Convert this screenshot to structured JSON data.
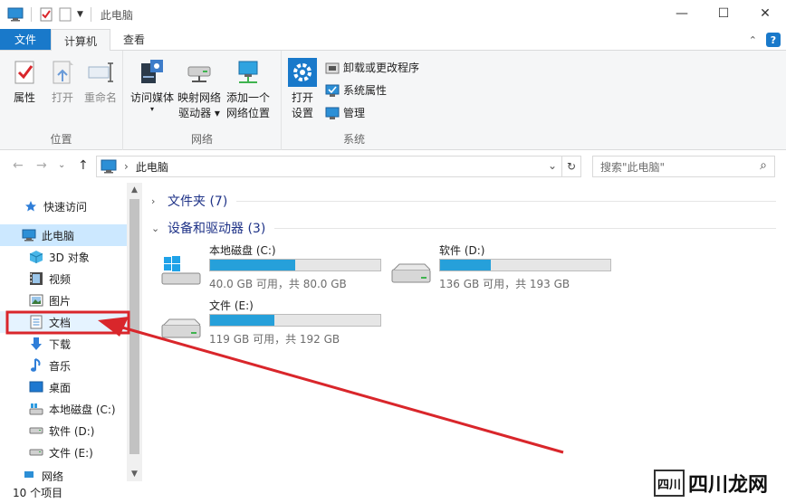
{
  "window": {
    "title": "此电脑",
    "minimize_glyph": "—",
    "maximize_glyph": "☐",
    "close_glyph": "✕"
  },
  "ribbon_tabs": [
    {
      "label": "文件"
    },
    {
      "label": "计算机"
    },
    {
      "label": "查看"
    }
  ],
  "ribbon": {
    "location_group": {
      "label": "位置",
      "buttons": [
        {
          "label": "属性",
          "icon": "properties-icon"
        },
        {
          "label": "打开",
          "icon": "open-icon"
        },
        {
          "label": "重命名",
          "icon": "rename-icon"
        }
      ]
    },
    "network_group": {
      "label": "网络",
      "buttons": [
        {
          "label_line1": "访问媒体",
          "label_line2": "▾",
          "icon": "media-server-icon"
        },
        {
          "label_line1": "映射网络",
          "label_line2": "驱动器 ▾",
          "icon": "map-drive-icon"
        },
        {
          "label_line1": "添加一个",
          "label_line2": "网络位置",
          "icon": "network-location-icon"
        }
      ]
    },
    "system_group": {
      "label": "系统",
      "open_settings_line1": "打开",
      "open_settings_line2": "设置",
      "small_buttons": [
        {
          "label": "卸载或更改程序",
          "icon": "uninstall-icon"
        },
        {
          "label": "系统属性",
          "icon": "system-properties-icon"
        },
        {
          "label": "管理",
          "icon": "manage-icon"
        }
      ]
    }
  },
  "address": {
    "back_glyph": "←",
    "forward_glyph": "→",
    "recent_glyph": "⌄",
    "up_glyph": "↑",
    "separator": "›",
    "path": "此电脑",
    "dropdown_glyph": "⌄",
    "refresh_glyph": "↻",
    "search_placeholder": "搜索\"此电脑\"",
    "search_glyph": "⌕"
  },
  "nav_pane": {
    "items": [
      {
        "label": "快速访问",
        "icon": "star-icon"
      },
      {
        "label": "此电脑",
        "icon": "computer-icon"
      },
      {
        "label": "3D 对象",
        "icon": "cube-icon"
      },
      {
        "label": "视频",
        "icon": "video-icon"
      },
      {
        "label": "图片",
        "icon": "pictures-icon"
      },
      {
        "label": "文档",
        "icon": "documents-icon"
      },
      {
        "label": "下载",
        "icon": "download-icon"
      },
      {
        "label": "音乐",
        "icon": "music-icon"
      },
      {
        "label": "桌面",
        "icon": "desktop-icon"
      },
      {
        "label": "本地磁盘 (C:)",
        "icon": "local-disk-icon"
      },
      {
        "label": "软件 (D:)",
        "icon": "drive-icon"
      },
      {
        "label": "文件 (E:)",
        "icon": "drive-icon"
      },
      {
        "label": "网络",
        "icon": "network-icon"
      }
    ],
    "scroll_up_glyph": "▲",
    "scroll_down_glyph": "▼"
  },
  "content": {
    "folders_section": {
      "label": "文件夹 (7)",
      "chevron": "›"
    },
    "drives_section": {
      "label": "设备和驱动器 (3)",
      "chevron": "⌄"
    },
    "drives": [
      {
        "name": "本地磁盘 (C:)",
        "free": "40.0 GB 可用，共 80.0 GB",
        "used_fraction": 0.5,
        "icon": "windows-drive-icon"
      },
      {
        "name": "软件 (D:)",
        "free": "136 GB 可用，共 193 GB",
        "used_fraction": 0.3,
        "icon": "drive-icon"
      },
      {
        "name": "文件 (E:)",
        "free": "119 GB 可用，共 192 GB",
        "used_fraction": 0.38,
        "icon": "drive-icon"
      }
    ]
  },
  "statusbar": {
    "item_count": "10 个项目"
  },
  "watermark": {
    "text": "四川龙网",
    "logo_text": "四川"
  },
  "colors": {
    "accent": "#1979ca",
    "drive_bar": "#26a0da",
    "annotation_red": "#d9262b",
    "selected_bg": "#cce8ff"
  }
}
